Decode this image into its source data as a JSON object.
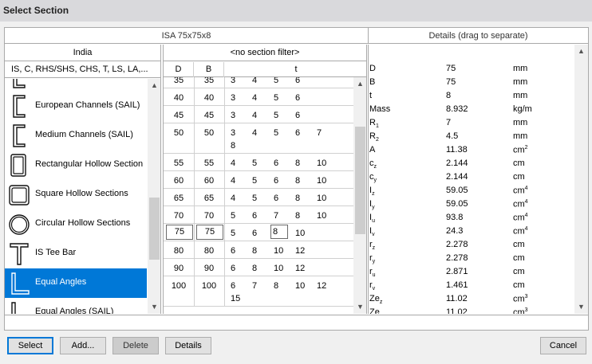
{
  "window": {
    "title": "Select Section"
  },
  "header": {
    "section_name": "ISA 75x75x8",
    "details_title": "Details (drag to separate)"
  },
  "left_panel": {
    "country": "India",
    "families": "IS, C, RHS/SHS, CHS, T, LS, LA,...",
    "items": [
      {
        "label": "",
        "icon": "channel-icon"
      },
      {
        "label": "European Channels (SAIL)",
        "icon": "channel-icon"
      },
      {
        "label": "Medium Channels (SAIL)",
        "icon": "channel-icon"
      },
      {
        "label": "Rectangular Hollow Section",
        "icon": "rectangular-hollow-icon"
      },
      {
        "label": "Square Hollow Sections",
        "icon": "square-hollow-icon"
      },
      {
        "label": "Circular Hollow Sections",
        "icon": "circular-hollow-icon"
      },
      {
        "label": "IS Tee Bar",
        "icon": "tee-icon"
      },
      {
        "label": "Equal Angles",
        "icon": "angle-icon",
        "selected": true
      },
      {
        "label": "Equal Angles (SAIL)",
        "icon": "angle-icon"
      }
    ],
    "scroll_position": 0.72
  },
  "table": {
    "filter": "<no section filter>",
    "columns": [
      "D",
      "B",
      "t"
    ],
    "rows": [
      {
        "D": "35",
        "B": "35",
        "t": [
          "3",
          "4",
          "5",
          "6"
        ]
      },
      {
        "D": "40",
        "B": "40",
        "t": [
          "3",
          "4",
          "5",
          "6"
        ]
      },
      {
        "D": "45",
        "B": "45",
        "t": [
          "3",
          "4",
          "5",
          "6"
        ]
      },
      {
        "D": "50",
        "B": "50",
        "t": [
          "3",
          "4",
          "5",
          "6",
          "7",
          "8"
        ]
      },
      {
        "D": "55",
        "B": "55",
        "t": [
          "4",
          "5",
          "6",
          "8",
          "10"
        ]
      },
      {
        "D": "60",
        "B": "60",
        "t": [
          "4",
          "5",
          "6",
          "8",
          "10"
        ]
      },
      {
        "D": "65",
        "B": "65",
        "t": [
          "4",
          "5",
          "6",
          "8",
          "10"
        ]
      },
      {
        "D": "70",
        "B": "70",
        "t": [
          "5",
          "6",
          "7",
          "8",
          "10"
        ]
      },
      {
        "D": "75",
        "B": "75",
        "t": [
          "5",
          "6",
          "8",
          "10"
        ],
        "selected_t": "8"
      },
      {
        "D": "80",
        "B": "80",
        "t": [
          "6",
          "8",
          "10",
          "12"
        ]
      },
      {
        "D": "90",
        "B": "90",
        "t": [
          "6",
          "8",
          "10",
          "12"
        ]
      },
      {
        "D": "100",
        "B": "100",
        "t": [
          "6",
          "7",
          "8",
          "10",
          "12",
          "15"
        ]
      }
    ],
    "scroll_position": 0.35
  },
  "details": {
    "rows": [
      {
        "name": "D",
        "sub": "",
        "value": "75",
        "unit": "mm",
        "sup": ""
      },
      {
        "name": "B",
        "sub": "",
        "value": "75",
        "unit": "mm",
        "sup": ""
      },
      {
        "name": "t",
        "sub": "",
        "value": "8",
        "unit": "mm",
        "sup": ""
      },
      {
        "name": "Mass",
        "sub": "",
        "value": "8.932",
        "unit": "kg/m",
        "sup": ""
      },
      {
        "name": "R",
        "sub": "1",
        "value": "7",
        "unit": "mm",
        "sup": ""
      },
      {
        "name": "R",
        "sub": "2",
        "value": "4.5",
        "unit": "mm",
        "sup": ""
      },
      {
        "name": "A",
        "sub": "",
        "value": "11.38",
        "unit": "cm",
        "sup": "2"
      },
      {
        "name": "c",
        "sub": "z",
        "value": "2.144",
        "unit": "cm",
        "sup": ""
      },
      {
        "name": "c",
        "sub": "y",
        "value": "2.144",
        "unit": "cm",
        "sup": ""
      },
      {
        "name": "I",
        "sub": "z",
        "value": "59.05",
        "unit": "cm",
        "sup": "4"
      },
      {
        "name": "I",
        "sub": "y",
        "value": "59.05",
        "unit": "cm",
        "sup": "4"
      },
      {
        "name": "I",
        "sub": "u",
        "value": "93.8",
        "unit": "cm",
        "sup": "4"
      },
      {
        "name": "I",
        "sub": "v",
        "value": "24.3",
        "unit": "cm",
        "sup": "4"
      },
      {
        "name": "r",
        "sub": "z",
        "value": "2.278",
        "unit": "cm",
        "sup": ""
      },
      {
        "name": "r",
        "sub": "y",
        "value": "2.278",
        "unit": "cm",
        "sup": ""
      },
      {
        "name": "r",
        "sub": "u",
        "value": "2.871",
        "unit": "cm",
        "sup": ""
      },
      {
        "name": "r",
        "sub": "v",
        "value": "1.461",
        "unit": "cm",
        "sup": ""
      },
      {
        "name": "Ze",
        "sub": "z",
        "value": "11.02",
        "unit": "cm",
        "sup": "3"
      },
      {
        "name": "Ze",
        "sub": "y",
        "value": "11.02",
        "unit": "cm",
        "sup": "3"
      }
    ]
  },
  "buttons": {
    "select": "Select",
    "add": "Add...",
    "delete": "Delete",
    "details": "Details",
    "cancel": "Cancel"
  }
}
